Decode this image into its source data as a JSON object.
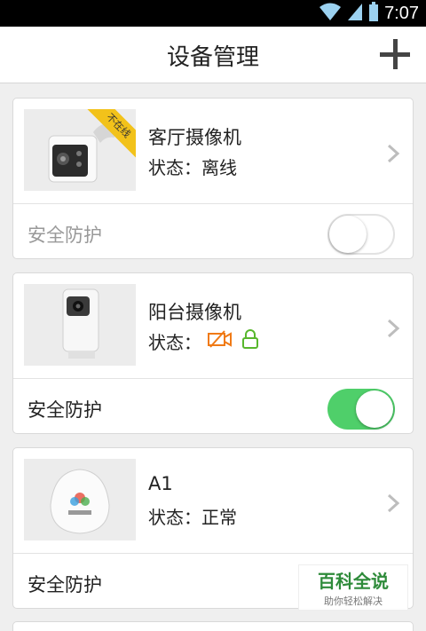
{
  "status_bar": {
    "time": "7:07"
  },
  "header": {
    "title": "设备管理"
  },
  "devices": [
    {
      "name": "客厅摄像机",
      "status_label": "状态：",
      "status_value": "离线",
      "badge": "不在线",
      "security_label": "安全防护",
      "security_on": false
    },
    {
      "name": "阳台摄像机",
      "status_label": "状态：",
      "status_value": "",
      "security_label": "安全防护",
      "security_on": true
    },
    {
      "name": "A1",
      "status_label": "状态：",
      "status_value": "正常",
      "security_label": "安全防护",
      "security_on": false
    }
  ],
  "watermark": {
    "main": "百科全说",
    "sub": "助你轻松解决"
  },
  "colors": {
    "toggle_on": "#4fcf6a",
    "badge": "#f2c21a",
    "video_off_icon": "#f07a16",
    "lock_icon": "#58b72c"
  }
}
